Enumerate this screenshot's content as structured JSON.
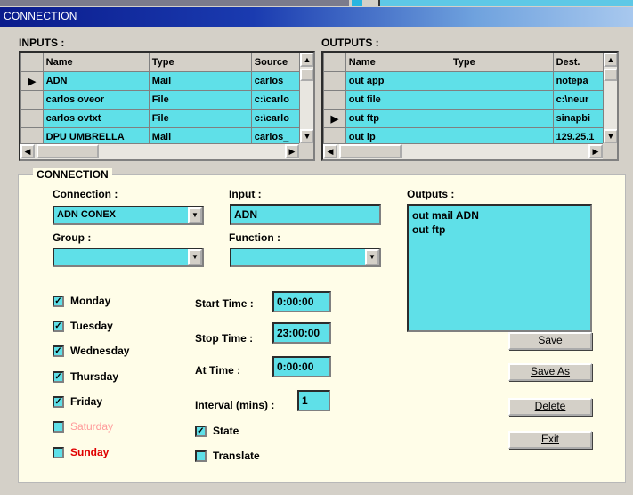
{
  "window": {
    "title": "CONNECTION"
  },
  "inputs": {
    "label": "INPUTS :",
    "columns": [
      "Name",
      "Type",
      "Source"
    ],
    "rows": [
      [
        "ADN",
        "Mail",
        "carlos_"
      ],
      [
        "carlos oveor",
        "File",
        "c:\\carlo"
      ],
      [
        "carlos ovtxt",
        "File",
        "c:\\carlo"
      ],
      [
        "DPU UMBRELLA",
        "Mail",
        "carlos_"
      ]
    ]
  },
  "outputs": {
    "label": "OUTPUTS :",
    "columns": [
      "Name",
      "Type",
      "Dest."
    ],
    "rows": [
      [
        "out app",
        "",
        "notepa"
      ],
      [
        "out file",
        "",
        "c:\\neur"
      ],
      [
        "out ftp",
        "",
        "sinapbi"
      ],
      [
        "out ip",
        "",
        "129.25.1"
      ]
    ]
  },
  "connection_panel": {
    "title": "CONNECTION",
    "connection_label": "Connection :",
    "connection_value": "ADN CONEX",
    "input_label": "Input :",
    "input_value": "ADN",
    "outputs_label": "Outputs :",
    "outputs_list": [
      "out mail ADN",
      "out ftp"
    ],
    "group_label": "Group :",
    "group_value": "",
    "function_label": "Function :",
    "function_value": "",
    "days": [
      {
        "label": "Monday",
        "checked": true,
        "color": "#000000"
      },
      {
        "label": "Tuesday",
        "checked": true,
        "color": "#000000"
      },
      {
        "label": "Wednesday",
        "checked": true,
        "color": "#000000"
      },
      {
        "label": "Thursday",
        "checked": true,
        "color": "#000000"
      },
      {
        "label": "Friday",
        "checked": true,
        "color": "#000000"
      },
      {
        "label": "Saturday",
        "checked": false,
        "color": "#ff9a9a"
      },
      {
        "label": "Sunday",
        "checked": false,
        "color": "#e00000"
      }
    ],
    "start_time_label": "Start Time :",
    "start_time_value": "0:00:00",
    "stop_time_label": "Stop Time :",
    "stop_time_value": "23:00:00",
    "at_time_label": "At Time :",
    "at_time_value": "0:00:00",
    "interval_label": "Interval (mins) :",
    "interval_value": "1",
    "state_label": "State",
    "state_checked": true,
    "translate_label": "Translate",
    "translate_checked": false
  },
  "buttons": {
    "save": "Save",
    "save_as": "Save As",
    "delete": "Delete",
    "exit": "Exit"
  },
  "colors": {
    "field": "#5fe0e8",
    "panel": "#fffde8",
    "title_bar": "#0a1b8c"
  }
}
